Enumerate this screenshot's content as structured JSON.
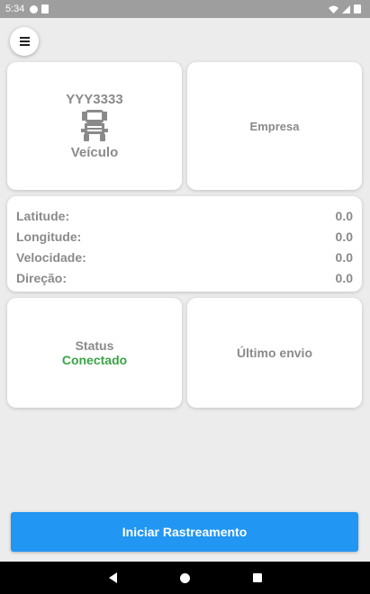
{
  "status_bar": {
    "time": "5:34"
  },
  "vehicle": {
    "plate": "YYY3333",
    "label": "Veículo",
    "icon": "truck-icon"
  },
  "company": {
    "label": "Empresa"
  },
  "coordinates": {
    "rows": [
      {
        "label": "Latitude:",
        "value": "0.0"
      },
      {
        "label": "Longitude:",
        "value": "0.0"
      },
      {
        "label": "Velocidade:",
        "value": "0.0"
      },
      {
        "label": "Direção:",
        "value": "0.0"
      }
    ]
  },
  "status": {
    "label": "Status",
    "value": "Conectado",
    "value_color": "#3aa447"
  },
  "last_send": {
    "label": "Último envio"
  },
  "action": {
    "start_label": "Iniciar Rastreamento",
    "color": "#2196f3"
  }
}
